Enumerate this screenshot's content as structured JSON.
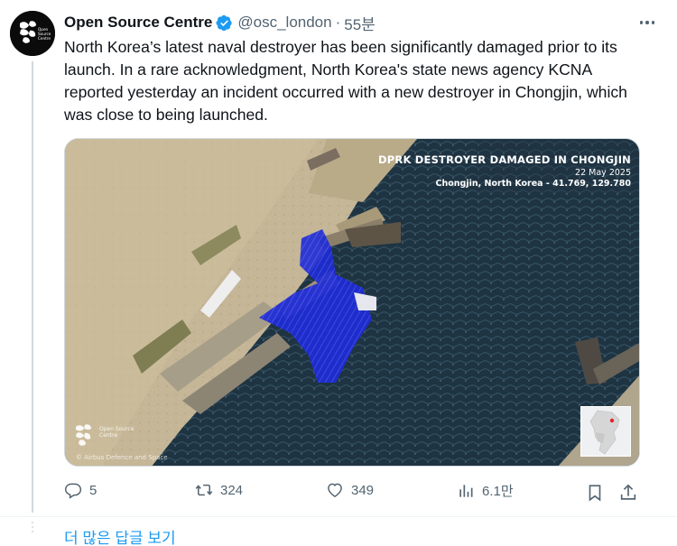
{
  "tweet": {
    "display_name": "Open Source Centre",
    "handle": "@osc_london",
    "separator": "·",
    "time": "55분",
    "text": "North Korea’s latest naval destroyer has been significantly damaged prior to its launch. In a rare acknowledgment, North Korea's state news agency KCNA reported yesterday an incident occurred with a new destroyer in Chongjin, which was close to being launched.",
    "verified_color": "#1d9bf0"
  },
  "media": {
    "overlay_title": "DPRK DESTROYER DAMAGED IN CHONGJIN",
    "overlay_date": "22 May 2025",
    "overlay_location": "Chongjin, North Korea - 41.769, 129.780",
    "watermark_brand": "Open Source Centre",
    "watermark_credit": "© Airbus Defence and Space"
  },
  "actions": {
    "replies": "5",
    "reposts": "324",
    "likes": "349",
    "views": "6.1만"
  },
  "more_replies_label": "더 많은 답글 보기",
  "colors": {
    "accent": "#1d9bf0",
    "muted": "#536471",
    "text": "#0f1419"
  },
  "icons": {
    "reply": "reply-icon",
    "repost": "repost-icon",
    "like": "heart-icon",
    "views": "views-icon",
    "bookmark": "bookmark-icon",
    "share": "share-icon",
    "more": "more-icon",
    "verified": "verified-badge-icon"
  }
}
